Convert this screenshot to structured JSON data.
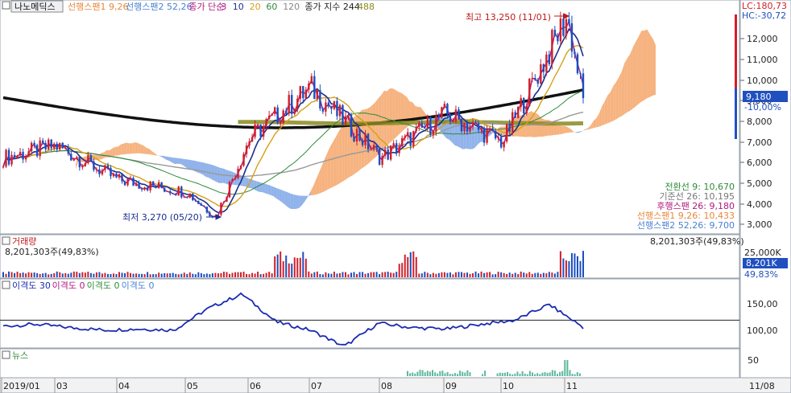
{
  "header": {
    "stock_name": "나노메딕스",
    "items": [
      {
        "text": "선행스팬1 9,26",
        "color": "#e8873a"
      },
      {
        "text": "선행스팬2 52,26",
        "color": "#4a7fd4"
      },
      {
        "text": "종가 단순",
        "color": "#b0187f"
      },
      {
        "text": "3",
        "color": "#b0187f"
      },
      {
        "text": "10",
        "color": "#1b2f8c"
      },
      {
        "text": "20",
        "color": "#d4a017"
      },
      {
        "text": "60",
        "color": "#2e8b3a"
      },
      {
        "text": "120",
        "color": "#888888"
      },
      {
        "text": "종가 지수 244",
        "color": "#222222"
      },
      {
        "text": "488",
        "color": "#8a8a20"
      }
    ],
    "lc": "LC:180,73",
    "hc": "HC:-30,72"
  },
  "annotations": {
    "high": "최고 13,250 (11/01)",
    "low": "최저 3,270 (05/20)"
  },
  "price_axis": {
    "ticks": [
      "12,000",
      "11,000",
      "10,000",
      "9,000",
      "8,000",
      "7,000",
      "6,000",
      "5,000",
      "4,000",
      "3,000"
    ],
    "current_price": "9,180",
    "current_change": "-10,00%"
  },
  "ichimoku_legend": [
    {
      "text": "전환선 9: 10,670",
      "color": "#2e8b3a"
    },
    {
      "text": "기준선 26: 10,195",
      "color": "#777777"
    },
    {
      "text": "후행스팬 26: 9,180",
      "color": "#b0187f"
    },
    {
      "text": "선행스팬1 9,26: 10,433",
      "color": "#e8873a"
    },
    {
      "text": "선행스팬2 52,26: 9,700",
      "color": "#4a7fd4"
    }
  ],
  "volume": {
    "title": "거래량",
    "value": "8,201,303주(49,83%)",
    "right_value": "8,201,303주(49,83%)",
    "axis_label": "25,000K",
    "badge": "8,201K",
    "badge_pct": "49,83%"
  },
  "disparity": {
    "labels": [
      {
        "text": "이격도 30",
        "color": "#1b2bb0"
      },
      {
        "text": "이격도 0",
        "color": "#b0187f"
      },
      {
        "text": "이격도 0",
        "color": "#2e8b3a"
      },
      {
        "text": "이격도 0",
        "color": "#4a7fd4"
      }
    ],
    "ticks": [
      "150,00",
      "100,00"
    ]
  },
  "news": {
    "title": "뉴스",
    "tick": "50"
  },
  "date_axis": {
    "labels": [
      "2019/01",
      "03",
      "04",
      "05",
      "06",
      "07",
      "08",
      "09",
      "10",
      "11"
    ],
    "right_label": "11/08"
  },
  "chart_data": [
    {
      "type": "line",
      "name": "price",
      "x": [
        "2019/01",
        "2019/03",
        "2019/04",
        "2019/05",
        "2019/05/20",
        "2019/06",
        "2019/07",
        "2019/08",
        "2019/09",
        "2019/10",
        "2019/11/01",
        "2019/11/08"
      ],
      "series": [
        {
          "name": "종가",
          "values": [
            6200,
            6800,
            5100,
            4500,
            3270,
            7200,
            9700,
            6200,
            8400,
            7000,
            13250,
            9180
          ]
        }
      ],
      "ylim": [
        2500,
        13500
      ]
    },
    {
      "type": "line",
      "name": "disparity",
      "series": [
        {
          "name": "이격도 30",
          "values": [
            105,
            108,
            102,
            98,
            100,
            98,
            135,
            160,
            112,
            98,
            70,
            110,
            102,
            100,
            108,
            115,
            142,
            103
          ]
        }
      ],
      "ylim": [
        70,
        175
      ]
    },
    {
      "type": "bar",
      "name": "volume",
      "values": [
        8201303
      ],
      "ylim": [
        0,
        25000000
      ]
    }
  ]
}
